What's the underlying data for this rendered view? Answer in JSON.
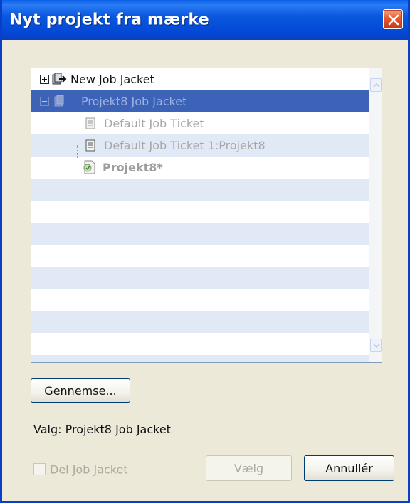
{
  "window": {
    "title": "Nyt projekt fra mærke"
  },
  "tree": {
    "nodes": [
      {
        "label": "New Job Jacket",
        "icon": "job-jacket-new-icon",
        "expander": "plus",
        "state": "normal"
      },
      {
        "label": "Projekt8 Job Jacket",
        "icon": "job-jacket-icon",
        "expander": "minus",
        "state": "selected"
      },
      {
        "label": "Default Job Ticket",
        "icon": "job-ticket-icon",
        "state": "disabled"
      },
      {
        "label": "Default Job Ticket 1:Projekt8",
        "icon": "job-ticket-icon",
        "state": "disabled"
      },
      {
        "label": "Projekt8*",
        "icon": "project-file-icon",
        "state": "disabled-bold"
      }
    ]
  },
  "buttons": {
    "browse": "Gennemse...",
    "choose": "Vælg",
    "cancel": "Annullér"
  },
  "selection": {
    "label": "Valg:",
    "value": "Projekt8 Job Jacket"
  },
  "share_checkbox": {
    "label": "Del Job Jacket",
    "checked": false
  },
  "colors": {
    "titlebar": "#0a58df",
    "selection_row": "#3d63b8",
    "stripe_row": "#e2e9f6",
    "dialog_bg": "#ece9d8"
  }
}
